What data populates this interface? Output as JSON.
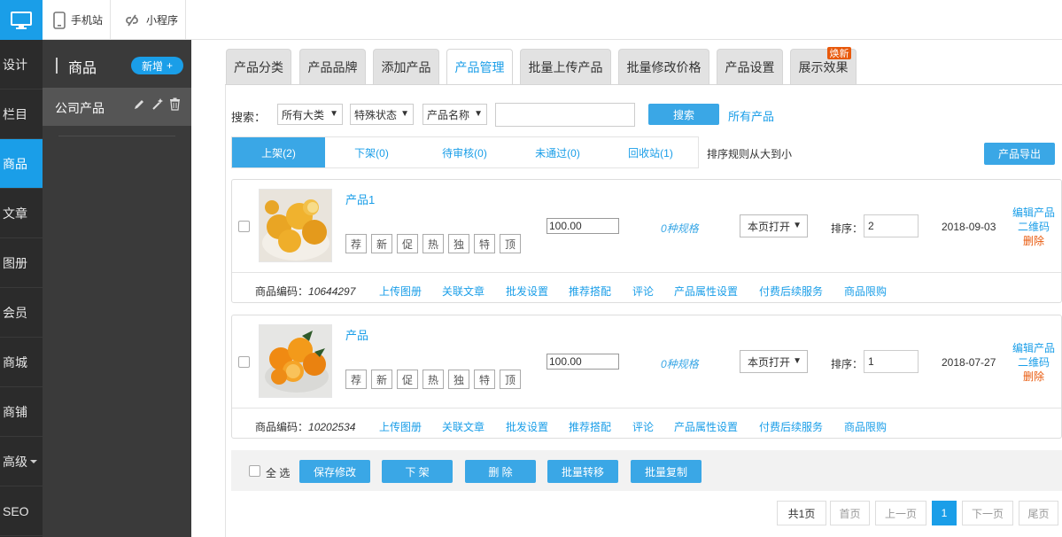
{
  "topbar": {
    "mobile_label": "手机站",
    "miniapp_label": "小程序"
  },
  "leftnav": {
    "items": [
      {
        "label": "设计",
        "active": false
      },
      {
        "label": "栏目",
        "active": false
      },
      {
        "label": "商品",
        "active": true
      },
      {
        "label": "文章",
        "active": false
      },
      {
        "label": "图册",
        "active": false
      },
      {
        "label": "会员",
        "active": false
      },
      {
        "label": "商城",
        "active": false
      },
      {
        "label": "商铺",
        "active": false
      },
      {
        "label": "高级",
        "active": false
      },
      {
        "label": "SEO",
        "active": false
      }
    ]
  },
  "subpanel": {
    "title": "商品",
    "new_label": "新增",
    "item_label": "公司产品"
  },
  "tabs": [
    {
      "label": "产品分类"
    },
    {
      "label": "产品品牌"
    },
    {
      "label": "添加产品"
    },
    {
      "label": "产品管理"
    },
    {
      "label": "批量上传产品"
    },
    {
      "label": "批量修改价格"
    },
    {
      "label": "产品设置"
    },
    {
      "label": "展示效果"
    }
  ],
  "tab_badge": "焕新",
  "search": {
    "label": "搜索：",
    "category": "所有大类",
    "status": "特殊状态",
    "field": "产品名称",
    "input_value": "",
    "button": "搜索",
    "all_link": "所有产品"
  },
  "status_tabs": [
    {
      "label": "上架(2)"
    },
    {
      "label": "下架(0)"
    },
    {
      "label": "待审核(0)"
    },
    {
      "label": "未通过(0)"
    },
    {
      "label": "回收站(1)"
    }
  ],
  "sort_rule": "排序规则从大到小",
  "export_button": "产品导出",
  "tag_labels": [
    "荐",
    "新",
    "促",
    "热",
    "独",
    "特",
    "顶"
  ],
  "labels": {
    "spec": "0种规格",
    "open_mode": "本页打开",
    "sort_label": "排序：",
    "edit": "编辑产品",
    "qrcode": "二维码",
    "delete": "删除",
    "code_label": "商品编码：",
    "foot_links": [
      "上传图册",
      "关联文章",
      "批发设置",
      "推荐搭配",
      "评论",
      "产品属性设置",
      "付费后续服务",
      "商品限购"
    ]
  },
  "products": [
    {
      "name": "产品1",
      "price": "100.00",
      "sort": "2",
      "date": "2018-09-03",
      "code": "10644297"
    },
    {
      "name": "产品",
      "price": "100.00",
      "sort": "1",
      "date": "2018-07-27",
      "code": "10202534"
    }
  ],
  "bulk": {
    "select_all": "全 选",
    "save": "保存修改",
    "offshelf": "下 架",
    "delete": "删 除",
    "transfer": "批量转移",
    "copy": "批量复制"
  },
  "pager": {
    "total": "共1页",
    "first": "首页",
    "prev": "上一页",
    "current": "1",
    "next": "下一页",
    "last": "尾页"
  },
  "colors": {
    "accent": "#1a9ee8",
    "button": "#3aa7e6",
    "danger": "#e8590c"
  }
}
